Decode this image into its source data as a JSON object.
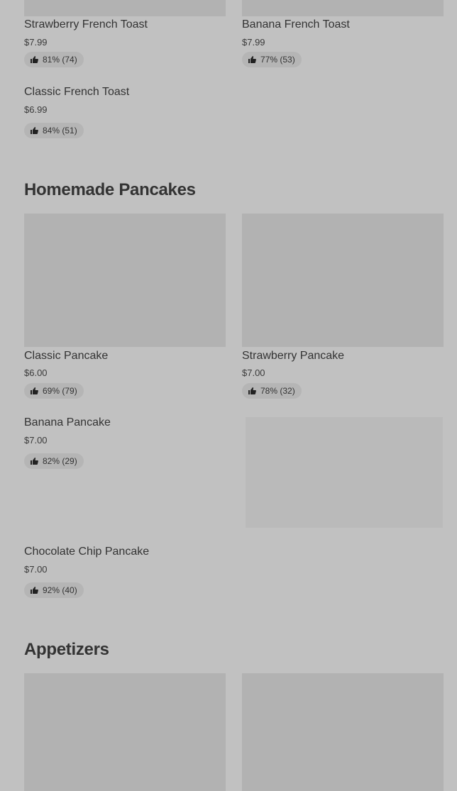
{
  "sections": {
    "french_toast": {
      "items": [
        {
          "name": "Strawberry French Toast",
          "price": "$7.99",
          "rating": "81% (74)"
        },
        {
          "name": "Banana French Toast",
          "price": "$7.99",
          "rating": "77% (53)"
        },
        {
          "name": "Classic French Toast",
          "price": "$6.99",
          "rating": "84% (51)"
        }
      ]
    },
    "pancakes": {
      "title": "Homemade Pancakes",
      "items": [
        {
          "name": "Classic Pancake",
          "price": "$6.00",
          "rating": "69% (79)"
        },
        {
          "name": "Strawberry Pancake",
          "price": "$7.00",
          "rating": "78% (32)"
        },
        {
          "name": "Banana Pancake",
          "price": "$7.00",
          "rating": "82% (29)"
        },
        {
          "name": "Chocolate Chip Pancake",
          "price": "$7.00",
          "rating": "92% (40)"
        }
      ]
    },
    "appetizers": {
      "title": "Appetizers"
    }
  },
  "icons": {
    "rating": "thumbs-up-icon"
  }
}
